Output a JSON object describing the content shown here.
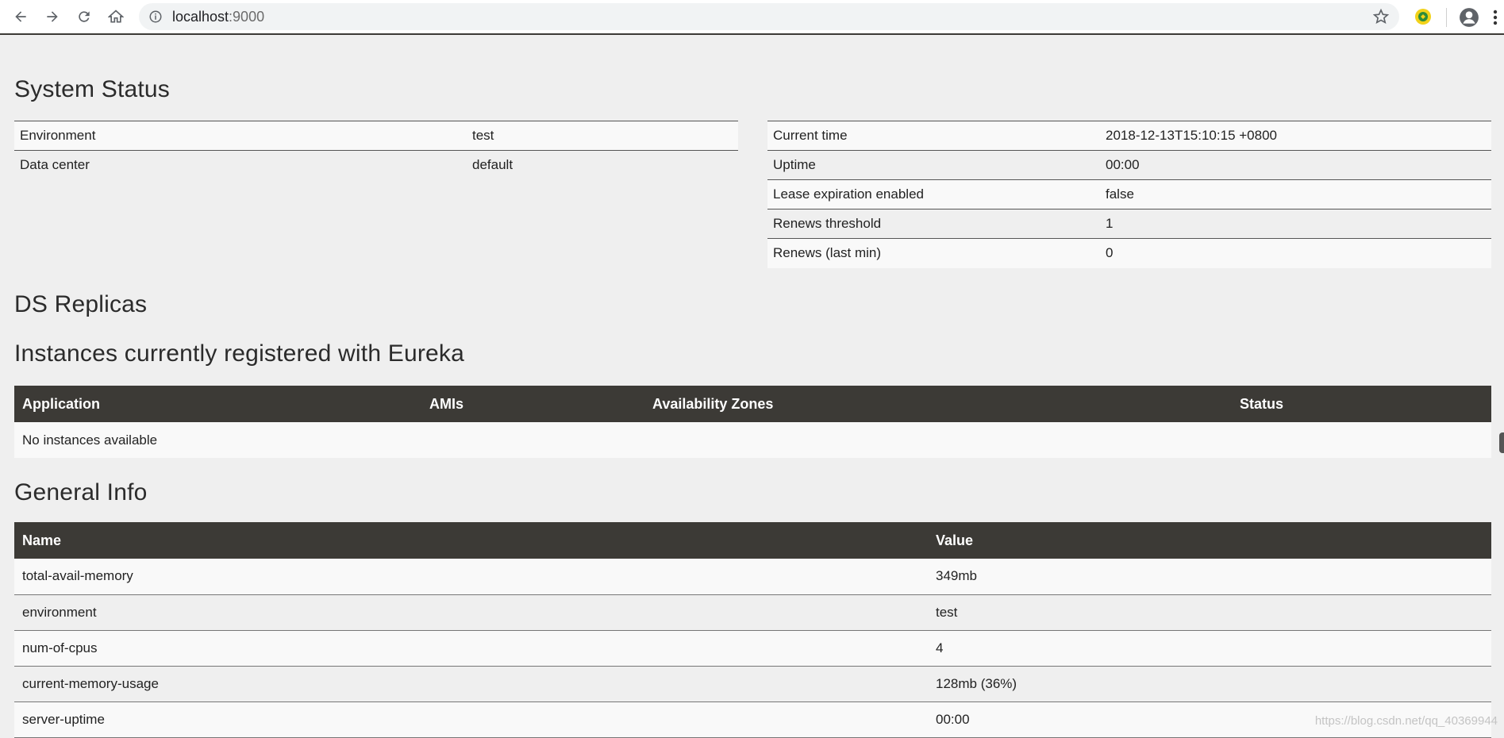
{
  "browser": {
    "url_host": "localhost",
    "url_port": ":9000"
  },
  "system_status": {
    "title": "System Status",
    "left": [
      {
        "label": "Environment",
        "value": "test"
      },
      {
        "label": "Data center",
        "value": "default"
      }
    ],
    "right": [
      {
        "label": "Current time",
        "value": "2018-12-13T15:10:15 +0800"
      },
      {
        "label": "Uptime",
        "value": "00:00"
      },
      {
        "label": "Lease expiration enabled",
        "value": "false"
      },
      {
        "label": "Renews threshold",
        "value": "1"
      },
      {
        "label": "Renews (last min)",
        "value": "0"
      }
    ]
  },
  "ds_replicas": {
    "title": "DS Replicas"
  },
  "instances": {
    "title": "Instances currently registered with Eureka",
    "headers": [
      "Application",
      "AMIs",
      "Availability Zones",
      "Status"
    ],
    "empty": "No instances available"
  },
  "general_info": {
    "title": "General Info",
    "headers": [
      "Name",
      "Value"
    ],
    "rows": [
      {
        "name": "total-avail-memory",
        "value": "349mb"
      },
      {
        "name": "environment",
        "value": "test"
      },
      {
        "name": "num-of-cpus",
        "value": "4"
      },
      {
        "name": "current-memory-usage",
        "value": "128mb (36%)"
      },
      {
        "name": "server-uptime",
        "value": "00:00"
      }
    ]
  },
  "watermark": "https://blog.csdn.net/qq_40369944"
}
